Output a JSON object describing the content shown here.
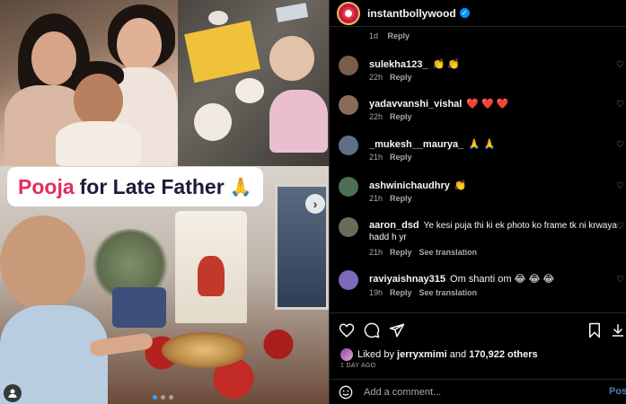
{
  "post": {
    "caption_word1": "Pooja",
    "caption_rest": "for Late Father",
    "caption_emoji": "🙏",
    "carousel_dots": 3,
    "active_dot": 0
  },
  "header": {
    "username": "instantbollywood",
    "verified_badge": "✓"
  },
  "previous_comment": {
    "time": "1d",
    "reply": "Reply"
  },
  "comments": [
    {
      "user": "sulekha123_",
      "text": "👏 👏",
      "time": "22h",
      "reply": "Reply",
      "translation": "",
      "avatar_color": "#7a5c48"
    },
    {
      "user": "yadavvanshi_vishal",
      "text": "❤️ ❤️ ❤️",
      "time": "22h",
      "reply": "Reply",
      "translation": "",
      "avatar_color": "#8a6a58"
    },
    {
      "user": "_mukesh__maurya_",
      "text": "🙏 🙏",
      "time": "21h",
      "reply": "Reply",
      "translation": "",
      "avatar_color": "#5f6e88"
    },
    {
      "user": "ashwinichaudhry",
      "text": "👏",
      "time": "21h",
      "reply": "Reply",
      "translation": "",
      "avatar_color": "#4f6f55"
    },
    {
      "user": "aaron_dsd",
      "text": "Ye kesi puja thi ki ek photo ko frame tk ni krwaya",
      "text2": "hadd h yr",
      "time": "21h",
      "reply": "Reply",
      "translation": "See translation",
      "avatar_color": "#6b6b58"
    },
    {
      "user": "raviyaishnay315",
      "text": "Om shanti om 😂 😂 😂",
      "time": "19h",
      "reply": "Reply",
      "translation": "See translation",
      "avatar_color": "#7a6ab8"
    }
  ],
  "likes": {
    "prefix": "Liked by",
    "user": "jerryxmimi",
    "middle": "and",
    "count": "170,922 others"
  },
  "post_date": "1 DAY AGO",
  "comment_box": {
    "placeholder": "Add a comment...",
    "post_label": "Post"
  },
  "colors": {
    "accent": "#0095f6",
    "caption_red": "#e22d5c",
    "post_button": "#4a7fb3"
  }
}
